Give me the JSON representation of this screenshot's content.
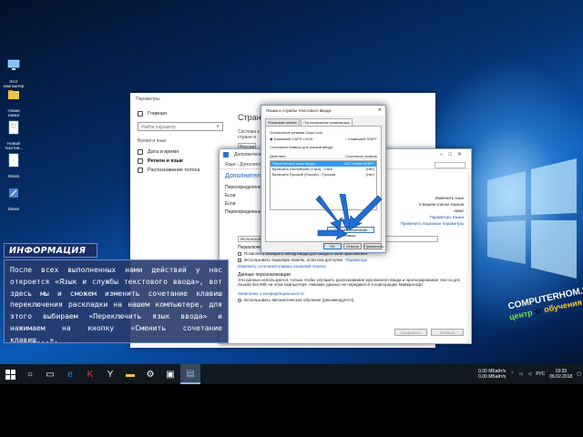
{
  "desktop": {
    "icons": [
      {
        "label": "Этот компьютер",
        "icon": "computer-icon"
      },
      {
        "label": "Новая папка",
        "icon": "folder-icon"
      },
      {
        "label": "Новый текстов...",
        "icon": "text-file-icon"
      },
      {
        "label": "Sleam",
        "icon": "file-icon"
      },
      {
        "label": "Sleam",
        "icon": "app-icon"
      }
    ]
  },
  "settings": {
    "title": "Параметры",
    "home": "Главная",
    "search_placeholder": "Найти параметр",
    "section": "Время и язык",
    "items": [
      "Дата и время",
      "Регион и язык",
      "Распознавание голоса"
    ],
    "heading": "Страна",
    "stub_text": "Система к стране и",
    "stub_value": "Россия"
  },
  "lang_options": {
    "title": "Дополнительные параметры",
    "address": "Язык › Дополнительные параметры",
    "left_header": "Дополнительно",
    "left_rows": [
      "Переопределение",
      "Если",
      "Если",
      "Переопределение"
    ],
    "right_links": [
      "Изменить язык",
      "в вашем списке языков",
      "ниже",
      "Параметры языка",
      "Применить языковые параметры"
    ],
    "dropdown_value": "Использовать список языков (рекомендуется)",
    "switch_section": "Переключение методов ввода",
    "checkbox1": "Позволить выбирать метод ввода для каждого окна приложения",
    "checkbox2": "Использовать языковую панель, если она доступна",
    "checkbox2_link": "Параметры",
    "change_link": "Изменить сочетания клавиш языковой панели",
    "data_section": "Данные персонализации",
    "data_text": "Эти данные используются, только чтобы улучшить распознавание рукописного ввода и прогнозирование текста для языков без IME на этом компьютере. Никакие данные не передаются в корпорацию Майкрософт.",
    "privacy_link": "Заявление о конфиденциальности",
    "radio_text": "Использовать автоматическое обучение (рекомендуется)",
    "btn_save": "Сохранить",
    "btn_cancel": "Отмена"
  },
  "dialog": {
    "title": "Языки и службы текстового ввода",
    "close": "✕",
    "tabs": [
      "Языковая панель",
      "Переключение клавиатуры"
    ],
    "group": "Отключение режима Caps Lock",
    "radio_on": "Клавишей CAPS LOCK",
    "radio_off": "Клавишей SHIFT",
    "hotkeys_header": "Сочетания клавиш для языков ввода",
    "col_action": "Действие",
    "col_keys": "Сочетание клавиш",
    "rows": [
      {
        "action": "Переключить язык ввода",
        "keys": "ALT слева+SHIFT"
      },
      {
        "action": "Включить Английский (США) - США",
        "keys": "(Нет)"
      },
      {
        "action": "Включить Русский (Россия) - Русская",
        "keys": "(Нет)"
      }
    ],
    "change_button": "Сменить сочетание клавиш...",
    "ok": "ОК",
    "cancel": "Отмена",
    "apply": "Применить"
  },
  "info": {
    "title": "ИНФОРМАЦИЯ",
    "text": "После всех выполненных нами действий у нас откроется «Язык и службы текстового ввода», вот здесь мы и сможем изменить сочетание клавиш переключения раскладки на нашем компьютере, для этого выбираем «Переключить язык ввода» и нажимаем на кнопку «Сменить сочетание клавиш...»."
  },
  "brand": {
    "line1": "COMPUTERHOM.RU",
    "line2a": "центр",
    "line2b": "обучения"
  },
  "taskbar": {
    "network_up": "0,00 МБайт/s",
    "network_down": "0,00 МБайт/s",
    "lang": "РУС",
    "time": "19:39",
    "date": "06.02.2018"
  }
}
